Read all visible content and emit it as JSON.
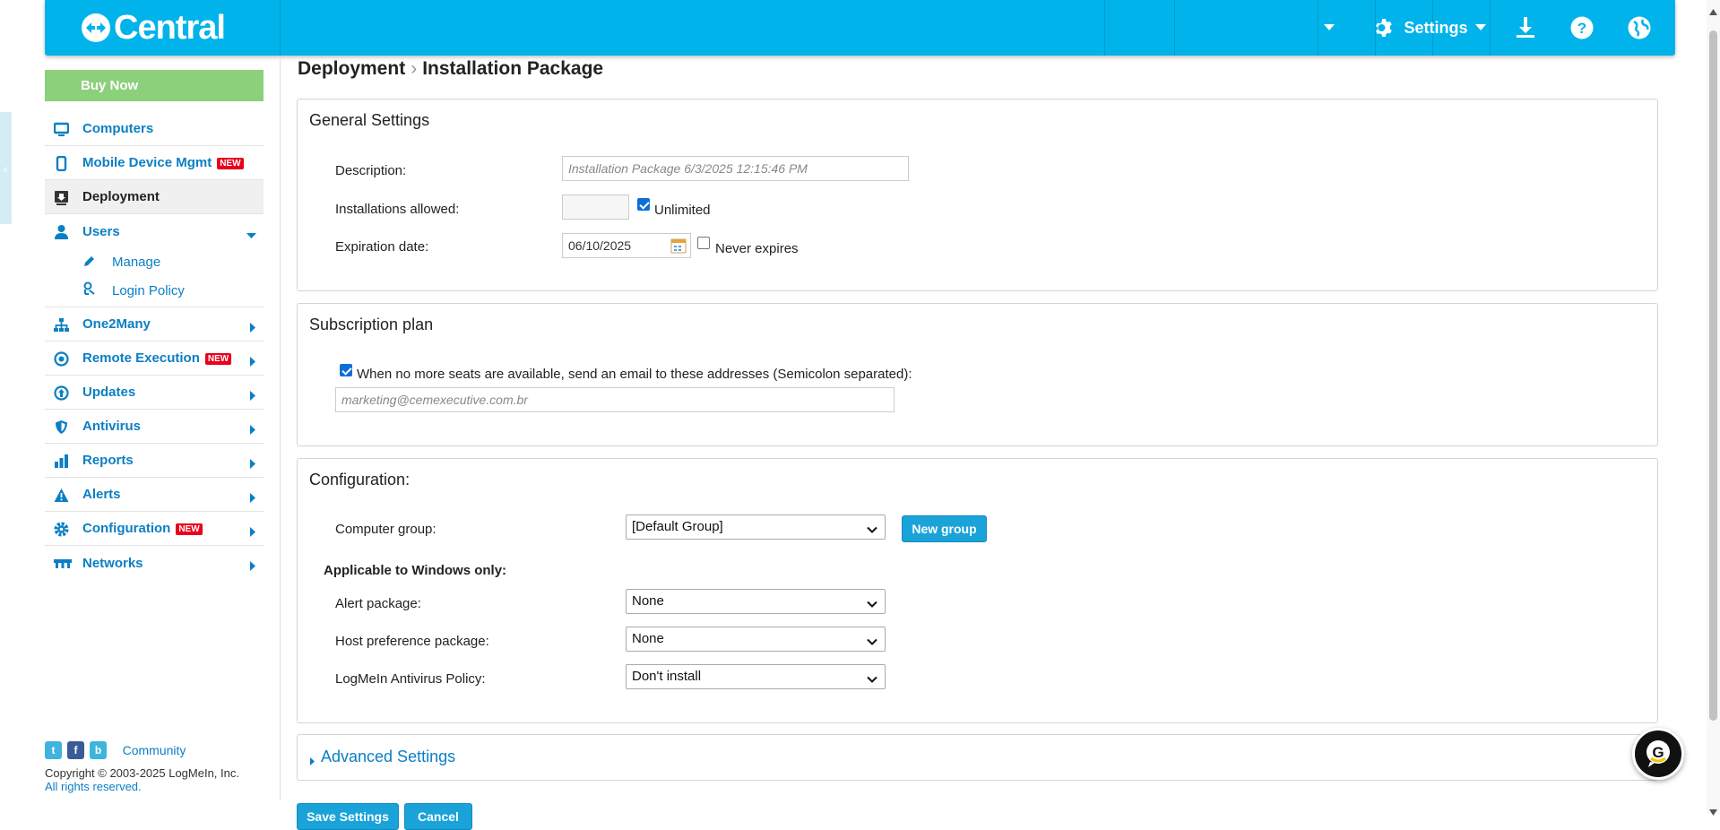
{
  "topbar": {
    "logo_text": "Central",
    "settings_label": "Settings",
    "icons": [
      "dropdown-arrow-icon",
      "gear-icon",
      "download-icon",
      "help-icon",
      "globe-icon"
    ]
  },
  "sidebar": {
    "buy_now": "Buy Now",
    "items": [
      {
        "label": "Computers",
        "icon": "monitor-icon"
      },
      {
        "label": "Mobile Device Mgmt",
        "icon": "mobile-icon",
        "badge": "NEW"
      },
      {
        "label": "Deployment",
        "icon": "deployment-icon",
        "active": true
      },
      {
        "label": "Users",
        "icon": "user-icon",
        "expanded": true,
        "children": [
          {
            "label": "Manage",
            "icon": "pencil-icon"
          },
          {
            "label": "Login Policy",
            "icon": "login-policy-icon"
          }
        ]
      },
      {
        "label": "One2Many",
        "icon": "hierarchy-icon"
      },
      {
        "label": "Remote Execution",
        "icon": "remote-exec-icon",
        "badge": "NEW"
      },
      {
        "label": "Updates",
        "icon": "update-icon"
      },
      {
        "label": "Antivirus",
        "icon": "shield-icon"
      },
      {
        "label": "Reports",
        "icon": "bar-chart-icon"
      },
      {
        "label": "Alerts",
        "icon": "warning-icon"
      },
      {
        "label": "Configuration",
        "icon": "gear-icon",
        "badge": "NEW"
      },
      {
        "label": "Networks",
        "icon": "network-icon"
      }
    ],
    "footer": {
      "social": [
        "twitter-icon",
        "facebook-icon",
        "blog-icon"
      ],
      "social_letters": [
        "t",
        "f",
        "b"
      ],
      "community": "Community",
      "copyright": "Copyright © 2003-2025 LogMeIn, Inc.",
      "rights": "All rights reserved."
    }
  },
  "breadcrumb": {
    "parent": "Deployment",
    "separator": "›",
    "current": "Installation Package"
  },
  "general": {
    "title": "General Settings",
    "description_label": "Description:",
    "description_placeholder": "Installation Package 6/3/2025 12:15:46 PM",
    "installs_label": "Installations allowed:",
    "installs_value": "",
    "unlimited_label": "Unlimited",
    "unlimited_checked": true,
    "expiration_label": "Expiration date:",
    "expiration_value": "06/10/2025",
    "never_expires_label": "Never expires",
    "never_expires_checked": false
  },
  "subscription": {
    "title": "Subscription plan",
    "notify_label": "When no more seats are available, send an email to these addresses (Semicolon separated):",
    "notify_checked": true,
    "email_placeholder": "marketing@cemexecutive.com.br"
  },
  "configuration": {
    "title": "Configuration:",
    "group_label": "Computer group:",
    "group_value": "[Default Group]",
    "new_group_button": "New group",
    "windows_heading": "Applicable to Windows only:",
    "alert_label": "Alert package:",
    "alert_value": "None",
    "host_label": "Host preference package:",
    "host_value": "None",
    "antivirus_label": "LogMeIn Antivirus Policy:",
    "antivirus_value": "Don't install"
  },
  "advanced": {
    "label": "Advanced Settings"
  },
  "footer_buttons": {
    "save": "Save Settings",
    "cancel": "Cancel"
  },
  "chat": {
    "letter": "G"
  }
}
